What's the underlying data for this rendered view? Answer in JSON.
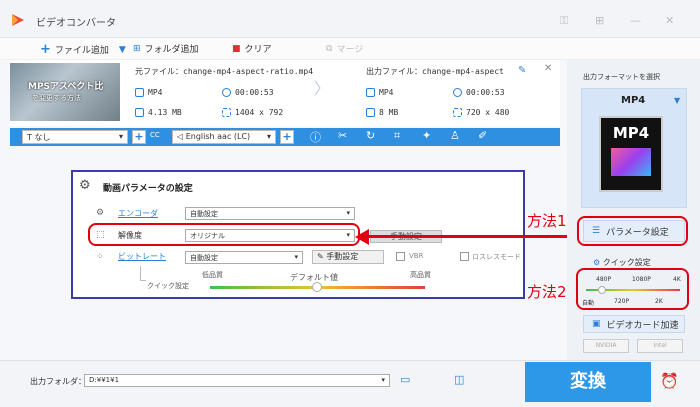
{
  "app": {
    "title": "ビデオコンバータ",
    "brand_color": "#2d97e8"
  },
  "toolbar": {
    "add_file": "ファイル追加",
    "add_folder": "フォルダ追加",
    "clear": "クリア",
    "merge": "マージ"
  },
  "file": {
    "thumb_text": [
      "MPSアスペクト比",
      "を変更する方法"
    ],
    "source_label": "元ファイル：change-mp4-aspect-ratio.mp4",
    "source_format": "MP4",
    "source_duration": "00:00:53",
    "source_size": "4.13 MB",
    "source_resolution": "1404 x 792",
    "output_label": "出力ファイル：change-mp4-aspect",
    "output_format": "MP4",
    "output_duration": "00:00:53",
    "output_size": "8 MB",
    "output_resolution": "720 x 480"
  },
  "editbar": {
    "subtitle": "なし",
    "audio": "English aac (LC)"
  },
  "dialog": {
    "title": "動画パラメータの設定",
    "encoder_label": "エンコーダ",
    "encoder_value": "自動設定",
    "resolution_label": "解像度",
    "resolution_value": "オリジナル",
    "manual": "手動設定",
    "bitrate_label": "ビットレート",
    "bitrate_value": "自動設定",
    "manual2": "手動設定",
    "vbr": "VBR",
    "lossless": "ロスレスモード",
    "quick_label": "クイック設定",
    "low": "低品質",
    "default": "デフォルト値",
    "high": "高品質"
  },
  "right": {
    "select_label": "出力フォーマットを選択",
    "format": "MP4",
    "card": "MP4",
    "param_btn": "パラメータ設定",
    "quick_title": "クイック設定",
    "quick_top": [
      "480P",
      "1080P",
      "4K"
    ],
    "quick_bottom": [
      "自動",
      "720P",
      "2K"
    ],
    "gpu_btn": "ビデオカード加速",
    "nvidia": "NVIDIA",
    "intel": "Intel"
  },
  "annotations": {
    "method1": "方法1",
    "method2": "方法2"
  },
  "bottom": {
    "folder_label": "出力フォルダ：",
    "folder_value": "D:¥¥1¥1",
    "convert": "変換"
  }
}
